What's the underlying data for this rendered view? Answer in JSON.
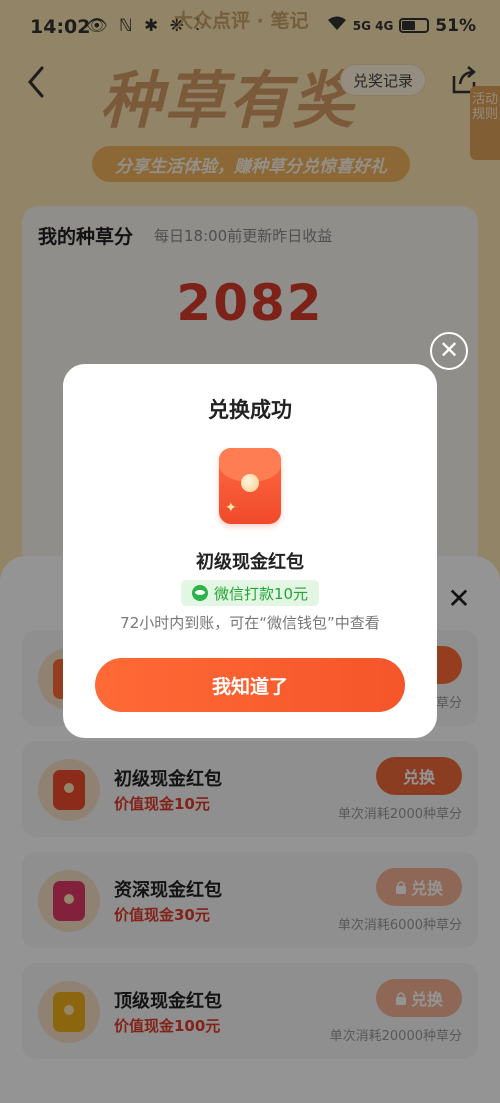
{
  "status_bar": {
    "time": "14:02",
    "left_icons": "👁 ℕ ✱ ❋ ⫶",
    "network": "5G 4G",
    "battery": "51%",
    "battery_level": 0.51,
    "app_name": "大众点评 · 笔记"
  },
  "header": {
    "back_icon": "chevron-left-icon",
    "banner_title": "种草有奖",
    "record_label": "兑奖记录",
    "share_icon": "share-icon",
    "rules_label": "活动规则",
    "slogan": "分享生活体验，赚种草分兑惊喜好礼"
  },
  "points_card": {
    "title": "我的种草分",
    "subtitle": "每日18:00前更新昨日收益",
    "score": "2082"
  },
  "reward_sheet": {
    "close_icon": "close-icon",
    "items": [
      {
        "name": "",
        "value": "",
        "button": "",
        "cost": "单次消耗1000种草分",
        "color": "#ff6a36",
        "locked": false
      },
      {
        "name": "初级现金红包",
        "value": "价值现金10元",
        "button": "兑换",
        "cost": "单次消耗2000种草分",
        "color": "#f04a2b",
        "locked": false
      },
      {
        "name": "资深现金红包",
        "value": "价值现金30元",
        "button": "兑换",
        "cost": "单次消耗6000种草分",
        "color": "#e23a6a",
        "locked": true
      },
      {
        "name": "顶级现金红包",
        "value": "价值现金100元",
        "button": "兑换",
        "cost": "单次消耗20000种草分",
        "color": "#f2b019",
        "locked": true
      }
    ]
  },
  "modal": {
    "close_icon": "close-circle-icon",
    "title": "兑换成功",
    "prize_name": "初级现金红包",
    "tag": "微信打款10元",
    "note": "72小时内到账，可在“微信钱包”中查看",
    "ok_label": "我知道了"
  },
  "colors": {
    "accent": "#f5552a",
    "score_red": "#d63b2b",
    "wechat_green": "#2ab34a"
  }
}
